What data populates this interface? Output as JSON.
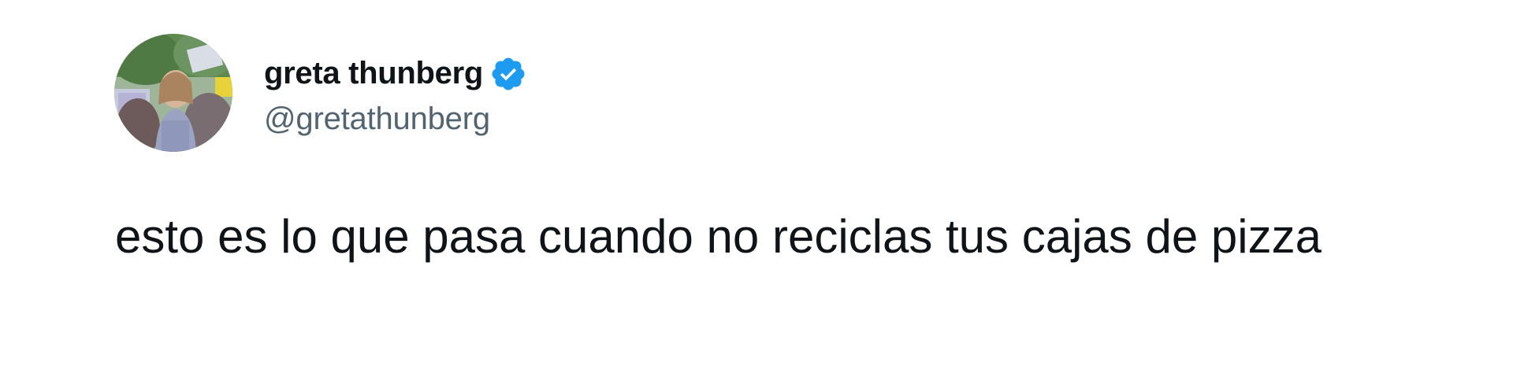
{
  "author": {
    "display_name": "greta thunberg",
    "handle": "@gretathunberg",
    "verified": true,
    "avatar_icon": "profile-photo"
  },
  "tweet": {
    "text": "esto es lo que pasa cuando no reciclas tus cajas de pizza"
  },
  "colors": {
    "name": "#0f1419",
    "handle": "#536471",
    "verified": "#1d9bf0",
    "background": "#ffffff"
  }
}
